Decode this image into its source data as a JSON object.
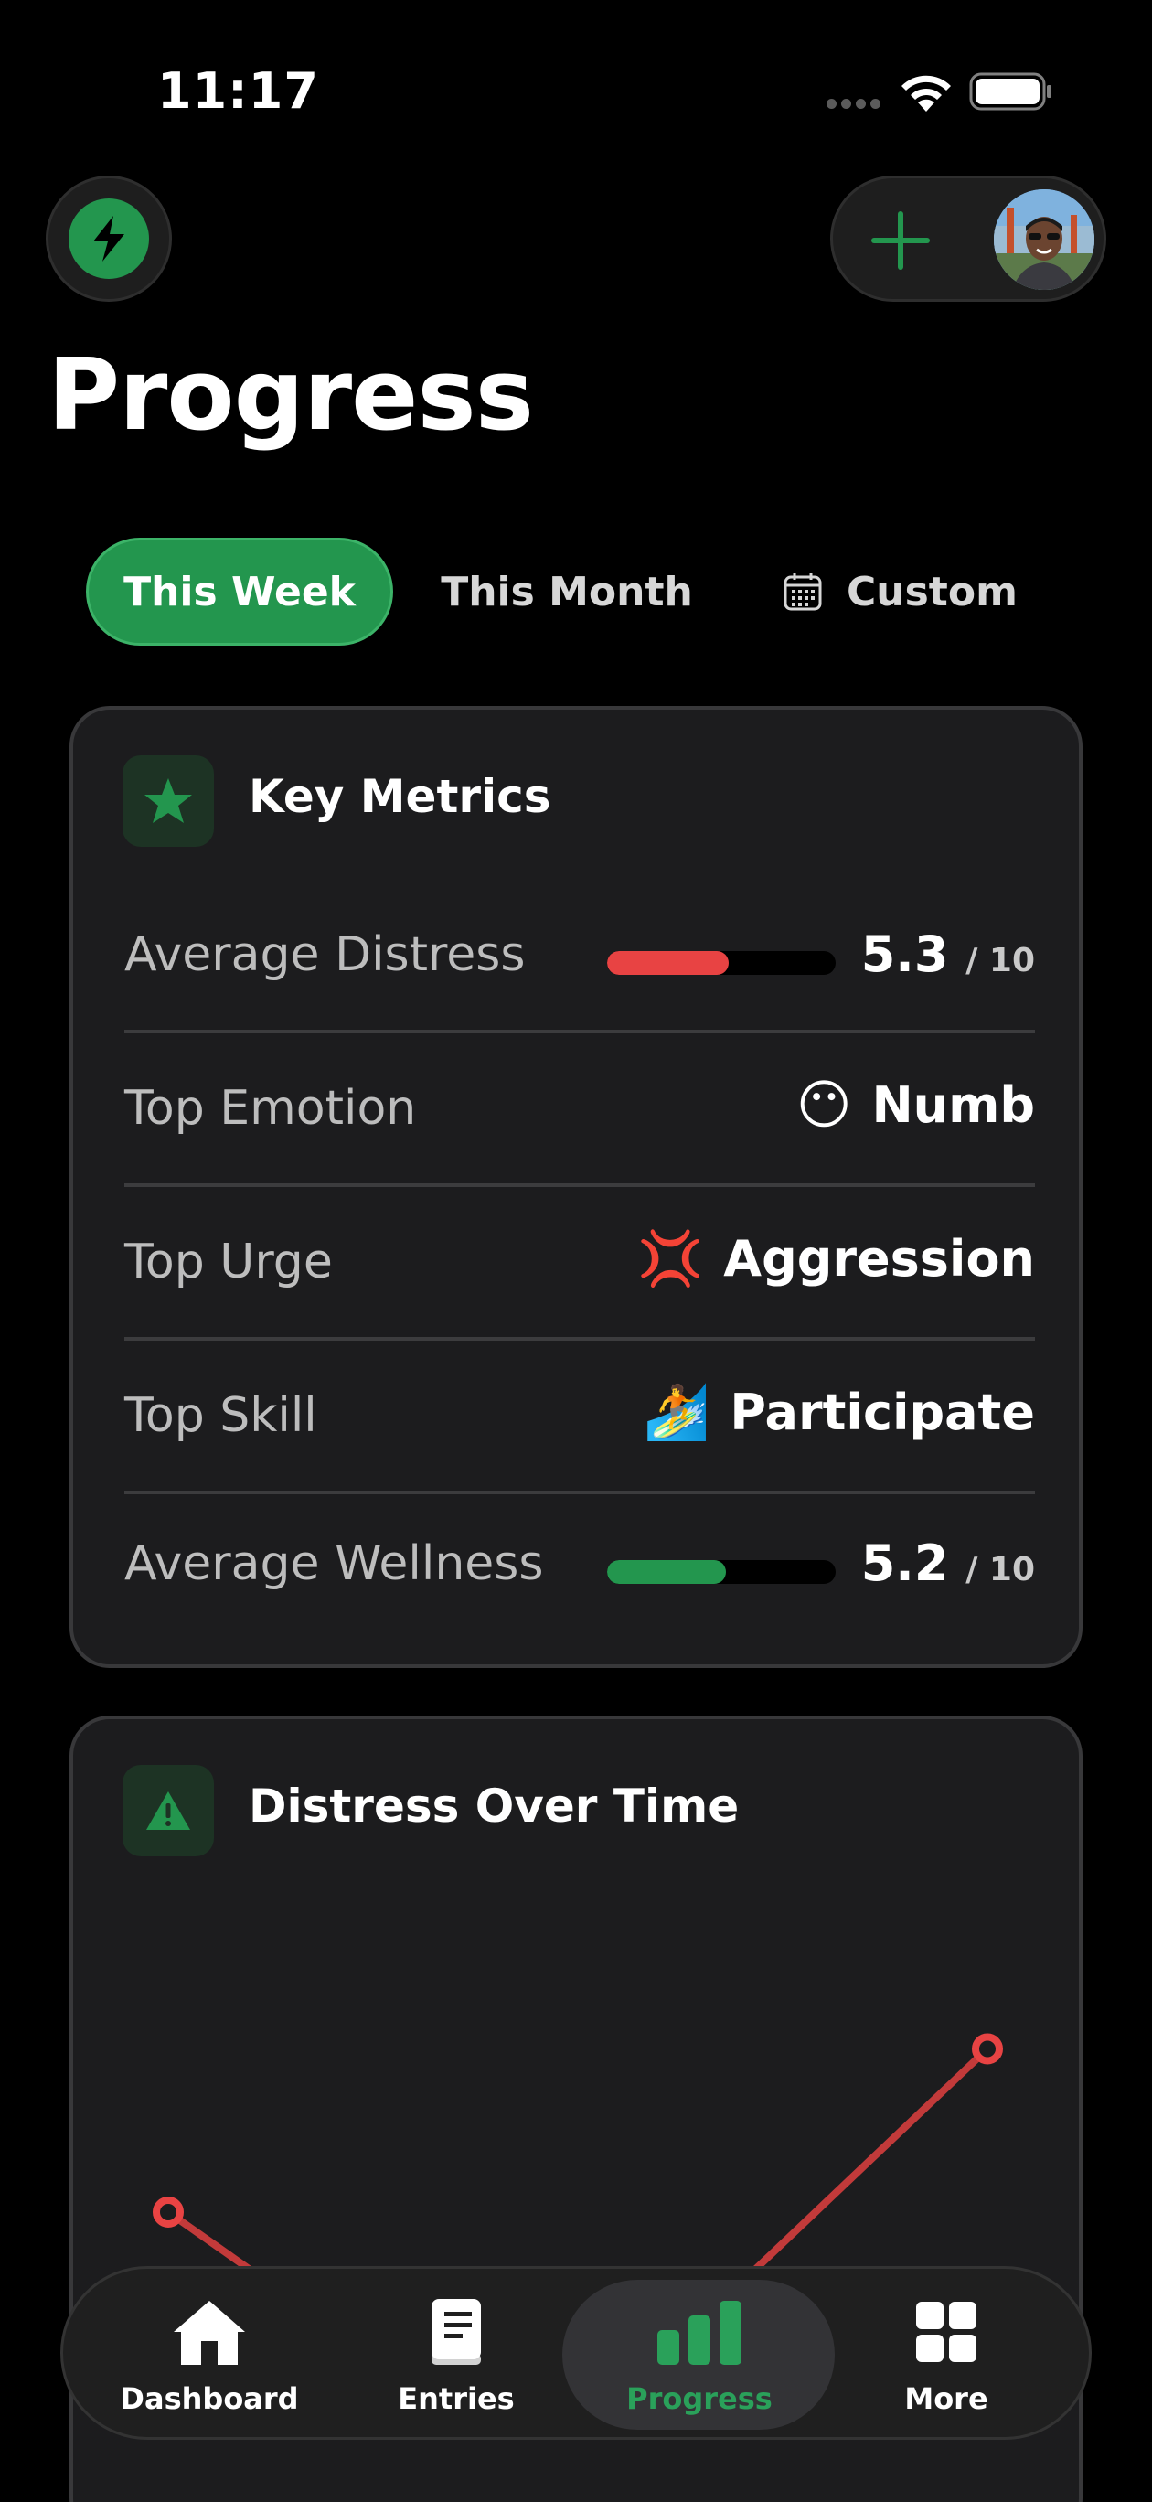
{
  "status": {
    "time": "11:17"
  },
  "header": {
    "title": "Progress"
  },
  "filters": {
    "this_week": "This Week",
    "this_month": "This Month",
    "custom": "Custom"
  },
  "metrics": {
    "title": "Key Metrics",
    "avg_distress": {
      "label": "Average Distress",
      "value": "5.3",
      "max": "/ 10",
      "fraction": 0.53,
      "color": "#e84343"
    },
    "top_emotion": {
      "label": "Top Emotion",
      "emoji": "😶",
      "value": "Numb"
    },
    "top_urge": {
      "label": "Top Urge",
      "emoji": "💢",
      "value": "Aggression"
    },
    "top_skill": {
      "label": "Top Skill",
      "emoji": "🏄",
      "value": "Participate"
    },
    "avg_wellness": {
      "label": "Average Wellness",
      "value": "5.2",
      "max": "/ 10",
      "fraction": 0.52,
      "color": "#23964e"
    }
  },
  "chart_card": {
    "title": "Distress Over Time"
  },
  "chart_data": {
    "type": "line",
    "title": "Distress Over Time",
    "xlabel": "",
    "ylabel": "",
    "series": [
      {
        "values": [
          6.2,
          4.2,
          5.2,
          7.9
        ],
        "color": "#c23a3a"
      }
    ],
    "ylim": [
      0,
      10
    ],
    "grid": false
  },
  "tabs": {
    "dashboard": "Dashboard",
    "entries": "Entries",
    "progress": "Progress",
    "more": "More"
  },
  "colors": {
    "accent": "#23964e",
    "distress": "#e84343",
    "background": "#000000",
    "card": "#1c1c1e"
  }
}
